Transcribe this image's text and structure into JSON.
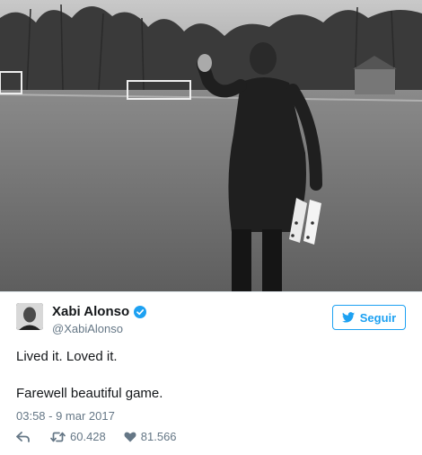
{
  "tweet": {
    "display_name": "Xabi Alonso",
    "handle": "@XabiAlonso",
    "follow_label": "Seguir",
    "text_line1": "Lived it. Loved it.",
    "text_line2": "Farewell beautiful game.",
    "timestamp": "03:58 - 9 mar 2017",
    "retweet_count": "60.428",
    "like_count": "81.566",
    "accent_color": "#1da1f2",
    "icons": [
      "verified-badge-icon",
      "twitter-bird-icon",
      "reply-icon",
      "retweet-icon",
      "heart-icon"
    ]
  },
  "photo": {
    "style": "black-and-white"
  }
}
